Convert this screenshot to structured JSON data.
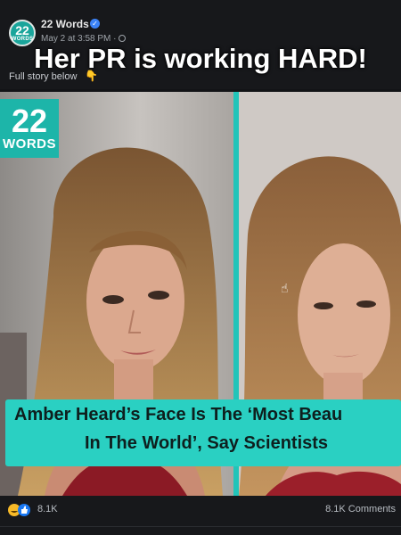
{
  "post": {
    "page_name": "22 Words",
    "timestamp": "May 2 at 3:58 PM ·",
    "caption_fragment": "Full story below",
    "overlay_title": "Her PR is working HARD!",
    "avatar": {
      "big": "22",
      "small": "WORDS"
    }
  },
  "image": {
    "logo": {
      "number": "22",
      "word": "WORDS"
    },
    "headline_line1": "Amber Heard’s Face Is The ‘Most Beau",
    "headline_line2": "In The World’, Say Scientists",
    "accent_color": "#2ad0c2"
  },
  "footer": {
    "reactions_count": "8.1K",
    "comments_count": "8.1K Comments"
  },
  "icons": [
    "verified-icon",
    "globe-icon",
    "point-down-icon",
    "haha-reaction-icon",
    "like-reaction-icon",
    "cursor-icon"
  ]
}
